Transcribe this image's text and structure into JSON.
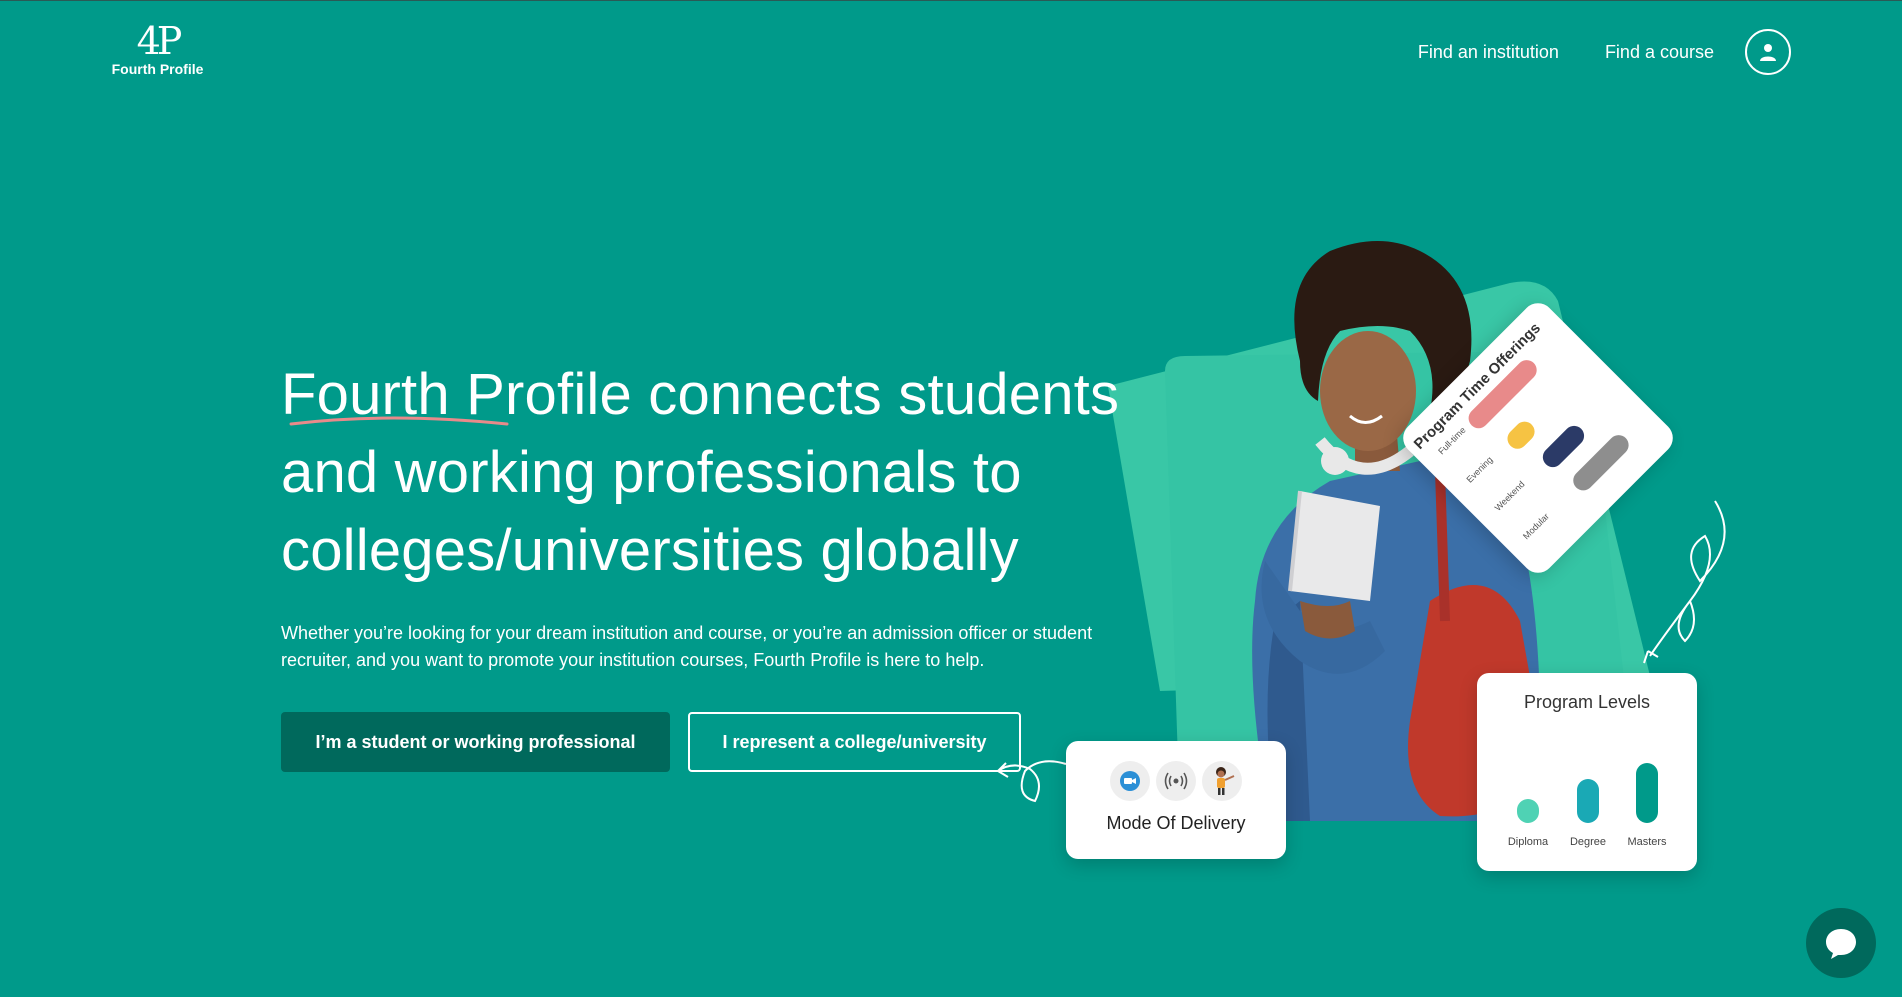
{
  "header": {
    "logo_mark": "4P",
    "logo_name": "Fourth Profile",
    "nav": {
      "find_institution": "Find an institution",
      "find_course": "Find a course"
    }
  },
  "hero": {
    "headline_highlight": "Fourth",
    "headline_rest_line1": " Profile connects students",
    "headline_line2": "and working professionals to",
    "headline_line3": "colleges/universities globally",
    "subtext": "Whether you’re looking for your dream institution and course, or you’re an admission officer or student recruiter, and you want to promote your institution courses, Fourth Profile is here to help.",
    "cta_student": "I’m a student or working professional",
    "cta_college": "I represent a college/university"
  },
  "illustration": {
    "program_time_title": "Program Time Offerings",
    "program_time_items": [
      "Full-time",
      "Evening",
      "Weekend",
      "Modular"
    ],
    "delivery_title": "Mode Of Delivery",
    "levels_title": "Program Levels",
    "levels": [
      {
        "label": "Diploma",
        "level": 0.3
      },
      {
        "label": "Degree",
        "level": 0.55
      },
      {
        "label": "Masters",
        "level": 0.75
      }
    ]
  },
  "colors": {
    "background": "#009a8a",
    "primary_button": "#00695c",
    "underline": "#e88a8a",
    "shape": "#4fd2b4"
  },
  "icons": [
    "user-icon",
    "video-call-icon",
    "broadcast-icon",
    "teacher-icon",
    "chat-icon"
  ]
}
